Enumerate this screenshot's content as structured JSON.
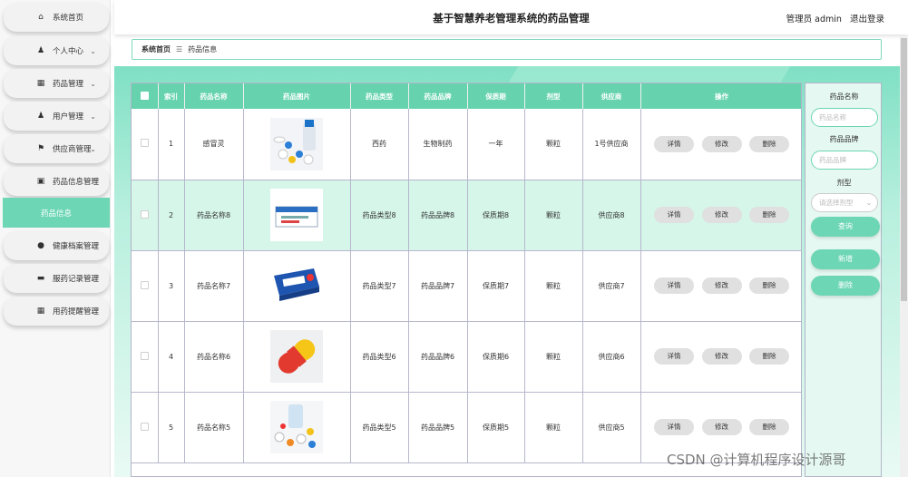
{
  "header": {
    "title": "基于智慧养老管理系统的药品管理",
    "admin_label": "管理员 admin",
    "logout": "退出登录"
  },
  "breadcrumb": {
    "home": "系统首页",
    "separator": "☰",
    "current": "药品信息"
  },
  "sidebar": {
    "items": [
      {
        "label": "系统首页",
        "icon": "home-icon",
        "glyph": "⌂",
        "chevron": ""
      },
      {
        "label": "个人中心",
        "icon": "person-icon",
        "glyph": "👤",
        "chevron": "⌄"
      },
      {
        "label": "药品管理",
        "icon": "grid-icon",
        "glyph": "▦",
        "chevron": "⌄"
      },
      {
        "label": "用户管理",
        "icon": "user-icon",
        "glyph": "👤",
        "chevron": "⌄"
      },
      {
        "label": "供应商管理",
        "icon": "flag-icon",
        "glyph": "⚑",
        "chevron": "⌄"
      },
      {
        "label": "药品信息管理",
        "icon": "chart-icon",
        "glyph": "▣",
        "chevron": "⌃"
      },
      {
        "label": "健康档案管理",
        "icon": "bulb-icon",
        "glyph": "●",
        "chevron": "⌄"
      },
      {
        "label": "服药记录管理",
        "icon": "monitor-icon",
        "glyph": "▬",
        "chevron": "⌄"
      },
      {
        "label": "用药提醒管理",
        "icon": "grid-icon",
        "glyph": "▦",
        "chevron": "⌄"
      }
    ],
    "active_sub": "药品信息"
  },
  "table": {
    "headers": [
      "索引",
      "药品名称",
      "药品图片",
      "药品类型",
      "药品品牌",
      "保质期",
      "剂型",
      "供应商",
      "操作"
    ],
    "rows": [
      {
        "index": "1",
        "name": "感冒灵",
        "type": "西药",
        "brand": "生物制药",
        "shelf": "一年",
        "form": "颗粒",
        "supplier": "1号供应商",
        "image": "pills-photo"
      },
      {
        "index": "2",
        "name": "药品名称8",
        "type": "药品类型8",
        "brand": "药品品牌8",
        "shelf": "保质期8",
        "form": "颗粒",
        "supplier": "供应商8",
        "image": "medicine-box-photo"
      },
      {
        "index": "3",
        "name": "药品名称7",
        "type": "药品类型7",
        "brand": "药品品牌7",
        "shelf": "保质期7",
        "form": "颗粒",
        "supplier": "供应商7",
        "image": "blue-box-photo"
      },
      {
        "index": "4",
        "name": "药品名称6",
        "type": "药品类型6",
        "brand": "药品品牌6",
        "shelf": "保质期6",
        "form": "颗粒",
        "supplier": "供应商6",
        "image": "capsule-photo"
      },
      {
        "index": "5",
        "name": "药品名称5",
        "type": "药品类型5",
        "brand": "药品品牌5",
        "shelf": "保质期5",
        "form": "颗粒",
        "supplier": "供应商5",
        "image": "tablets-photo"
      }
    ],
    "actions": {
      "detail": "详情",
      "edit": "修改",
      "delete": "删除"
    }
  },
  "search": {
    "name_label": "药品名称",
    "name_placeholder": "药品名称",
    "brand_label": "药品品牌",
    "brand_placeholder": "药品品牌",
    "form_label": "剂型",
    "form_placeholder": "请选择剂型",
    "query": "查询",
    "add": "新增",
    "delete": "删除"
  },
  "watermark": "CSDN @计算机程序设计源哥",
  "colors": {
    "accent": "#6dd6b5",
    "header_row": "#66d3ae",
    "alt_row": "#d6f6ea"
  }
}
